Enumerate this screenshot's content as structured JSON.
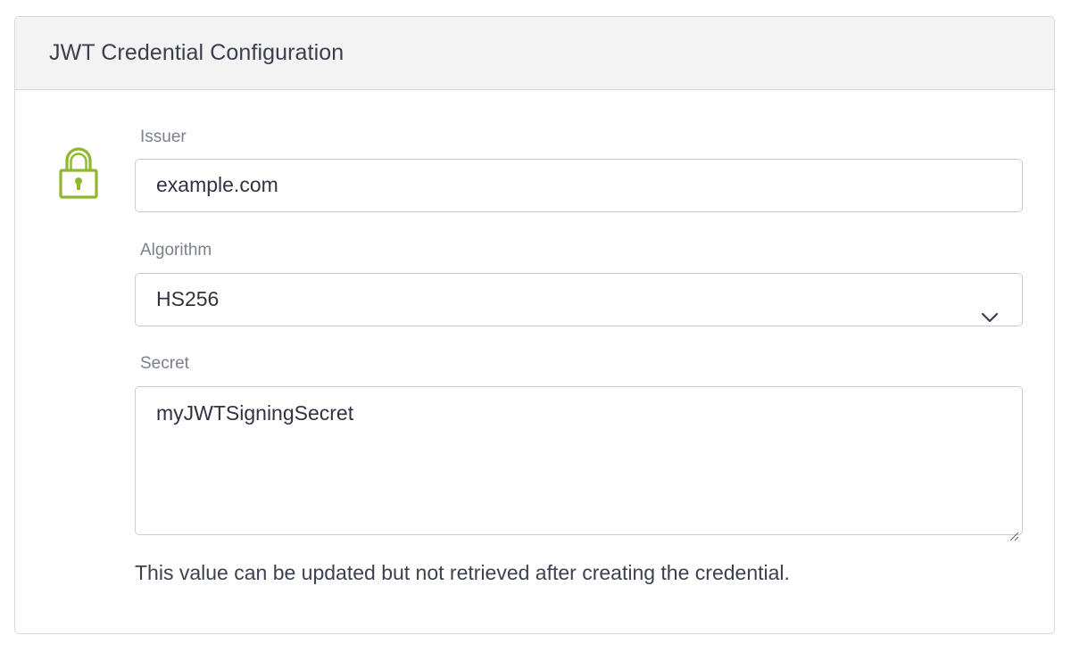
{
  "card": {
    "title": "JWT Credential Configuration"
  },
  "icons": {
    "lock": "lock-icon",
    "chevron": "chevron-down-icon",
    "resize": "resize-handle-icon"
  },
  "colors": {
    "accent": "#8fb82e",
    "header_bg": "#f3f3f3",
    "border": "#d6d8db"
  },
  "issuer": {
    "label": "Issuer",
    "value": "example.com"
  },
  "algorithm": {
    "label": "Algorithm",
    "value": "HS256"
  },
  "secret": {
    "label": "Secret",
    "value": "myJWTSigningSecret",
    "help": "This value can be updated but not retrieved after creating the credential."
  }
}
